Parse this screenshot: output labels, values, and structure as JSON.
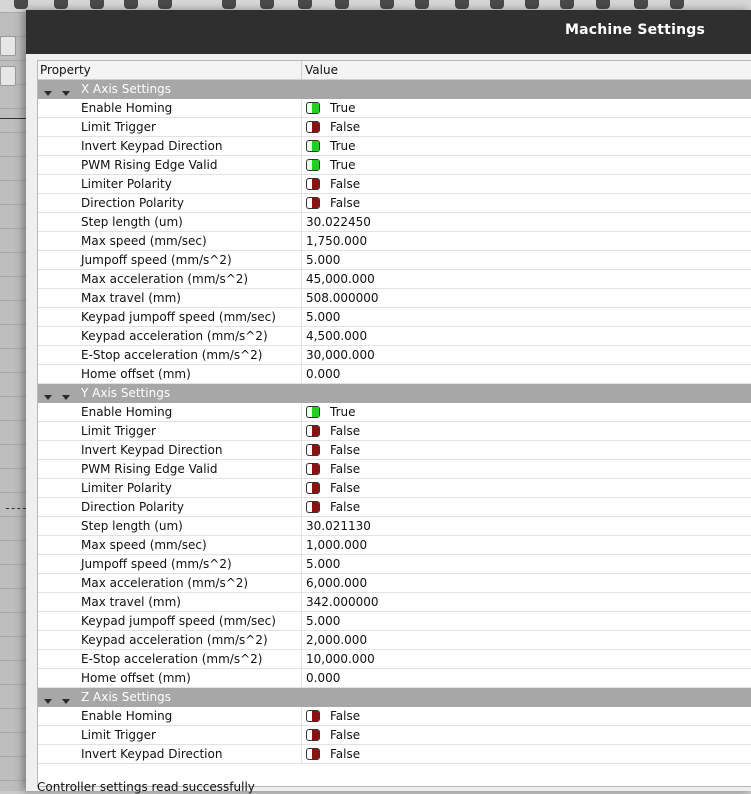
{
  "dialog": {
    "title": "Machine Settings",
    "status": "Controller settings read successfully"
  },
  "header": {
    "property": "Property",
    "value": "Value"
  },
  "colors": {
    "true_toggle": "#1fd21f",
    "false_toggle": "#8b1010",
    "group_header": "#a7a7a7",
    "titlebar": "#2f2f2f"
  },
  "groups": [
    {
      "title": "X Axis Settings",
      "rows": [
        {
          "prop": "Enable Homing",
          "type": "bool",
          "value": "True"
        },
        {
          "prop": "Limit Trigger",
          "type": "bool",
          "value": "False"
        },
        {
          "prop": "Invert Keypad Direction",
          "type": "bool",
          "value": "True"
        },
        {
          "prop": "PWM Rising Edge Valid",
          "type": "bool",
          "value": "True"
        },
        {
          "prop": "Limiter Polarity",
          "type": "bool",
          "value": "False"
        },
        {
          "prop": "Direction Polarity",
          "type": "bool",
          "value": "False"
        },
        {
          "prop": "Step length (um)",
          "type": "num",
          "value": "30.022450"
        },
        {
          "prop": "Max speed (mm/sec)",
          "type": "num",
          "value": "1,750.000"
        },
        {
          "prop": "Jumpoff speed (mm/s^2)",
          "type": "num",
          "value": "5.000"
        },
        {
          "prop": "Max acceleration (mm/s^2)",
          "type": "num",
          "value": "45,000.000"
        },
        {
          "prop": "Max travel (mm)",
          "type": "num",
          "value": "508.000000"
        },
        {
          "prop": "Keypad jumpoff speed (mm/sec)",
          "type": "num",
          "value": "5.000"
        },
        {
          "prop": "Keypad acceleration (mm/s^2)",
          "type": "num",
          "value": "4,500.000"
        },
        {
          "prop": "E-Stop acceleration (mm/s^2)",
          "type": "num",
          "value": "30,000.000"
        },
        {
          "prop": "Home offset (mm)",
          "type": "num",
          "value": "0.000"
        }
      ]
    },
    {
      "title": "Y Axis Settings",
      "rows": [
        {
          "prop": "Enable Homing",
          "type": "bool",
          "value": "True"
        },
        {
          "prop": "Limit Trigger",
          "type": "bool",
          "value": "False"
        },
        {
          "prop": "Invert Keypad Direction",
          "type": "bool",
          "value": "False"
        },
        {
          "prop": "PWM Rising Edge Valid",
          "type": "bool",
          "value": "False"
        },
        {
          "prop": "Limiter Polarity",
          "type": "bool",
          "value": "False"
        },
        {
          "prop": "Direction Polarity",
          "type": "bool",
          "value": "False"
        },
        {
          "prop": "Step length (um)",
          "type": "num",
          "value": "30.021130"
        },
        {
          "prop": "Max speed (mm/sec)",
          "type": "num",
          "value": "1,000.000"
        },
        {
          "prop": "Jumpoff speed (mm/s^2)",
          "type": "num",
          "value": "5.000"
        },
        {
          "prop": "Max acceleration (mm/s^2)",
          "type": "num",
          "value": "6,000.000"
        },
        {
          "prop": "Max travel (mm)",
          "type": "num",
          "value": "342.000000"
        },
        {
          "prop": "Keypad jumpoff speed (mm/sec)",
          "type": "num",
          "value": "5.000"
        },
        {
          "prop": "Keypad acceleration (mm/s^2)",
          "type": "num",
          "value": "2,000.000"
        },
        {
          "prop": "E-Stop acceleration (mm/s^2)",
          "type": "num",
          "value": "10,000.000"
        },
        {
          "prop": "Home offset (mm)",
          "type": "num",
          "value": "0.000"
        }
      ]
    },
    {
      "title": "Z Axis Settings",
      "rows": [
        {
          "prop": "Enable Homing",
          "type": "bool",
          "value": "False"
        },
        {
          "prop": "Limit Trigger",
          "type": "bool",
          "value": "False"
        },
        {
          "prop": "Invert Keypad Direction",
          "type": "bool",
          "value": "False"
        }
      ]
    }
  ]
}
